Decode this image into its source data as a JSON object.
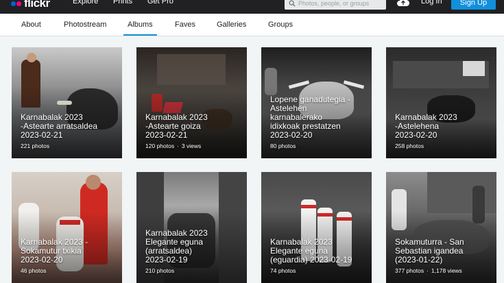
{
  "header": {
    "logo": "flickr",
    "logo_colors": [
      "#0063dc",
      "#ff0084"
    ],
    "nav": [
      "Explore",
      "Prints",
      "Get Pro"
    ],
    "search_placeholder": "Photos, people, or groups",
    "upload_icon": "cloud-upload-icon",
    "login": "Log In",
    "signup": "Sign Up",
    "accent": "#128fdc"
  },
  "tabs": [
    "About",
    "Photostream",
    "Albums",
    "Faves",
    "Galleries",
    "Groups"
  ],
  "active_tab": "Albums",
  "albums": [
    {
      "title": "Karnabalak 2023 -Asteartearratsaldea 2023-02-21",
      "title_lines": [
        "Karnabalak 2023",
        "-Astearte arratsaldea",
        "2023-02-21"
      ],
      "photos": "221 photos",
      "views": ""
    },
    {
      "title_lines": [
        "Karnabalak 2023",
        "-Astearte goiza",
        "2023-02-21"
      ],
      "photos": "120 photos",
      "views": "3 views"
    },
    {
      "title_lines": [
        "Lopene ganadutegia -",
        "Astelehen",
        "karnabalerako",
        "idixkoak prestatzen",
        "2023-02-20"
      ],
      "photos": "80 photos",
      "views": ""
    },
    {
      "title_lines": [
        "Karnabalak 2023",
        "-Astelehena",
        "2023-02-20"
      ],
      "photos": "258 photos",
      "views": ""
    },
    {
      "title_lines": [
        "Karnabalak 2023 -",
        "Sokamutur txikia",
        "2023-02-20"
      ],
      "photos": "46 photos",
      "views": ""
    },
    {
      "title_lines": [
        "Karnabalak 2023",
        "Elegante eguna",
        "(arratsaldea)",
        "2023-02-19"
      ],
      "photos": "210 photos",
      "views": ""
    },
    {
      "title_lines": [
        "Karnabalak 2023",
        "Elegante eguna",
        "(eguardia) 2023-02-19"
      ],
      "photos": "74 photos",
      "views": ""
    },
    {
      "title_lines": [
        "Sokamuturra - San",
        "Sebastian igandea",
        "(2023-01-22)"
      ],
      "photos": "377 photos",
      "views": "1,178 views"
    }
  ]
}
